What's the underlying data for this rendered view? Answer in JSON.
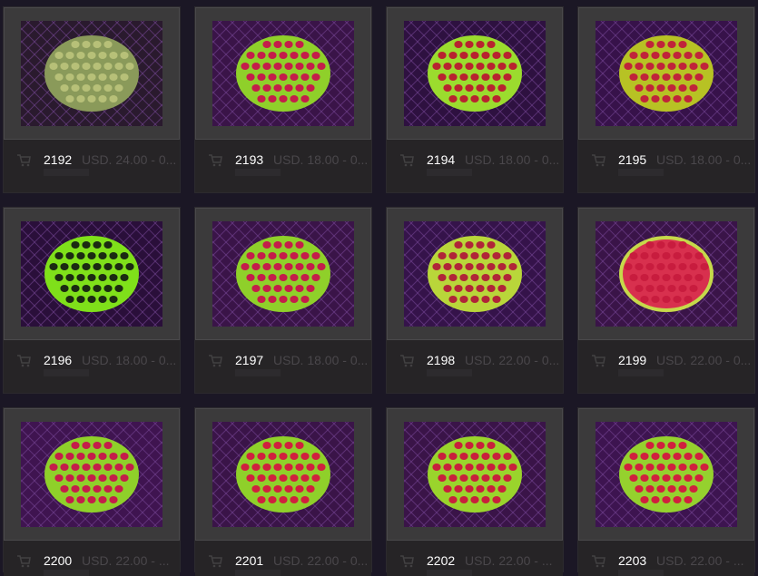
{
  "products": [
    {
      "title": "2192",
      "price": "USD. 24.00 - 0..."
    },
    {
      "title": "2193",
      "price": "USD. 18.00 - 0..."
    },
    {
      "title": "2194",
      "price": "USD. 18.00 - 0..."
    },
    {
      "title": "2195",
      "price": "USD. 18.00 - 0..."
    },
    {
      "title": "2196",
      "price": "USD. 18.00 - 0..."
    },
    {
      "title": "2197",
      "price": "USD. 18.00 - 0..."
    },
    {
      "title": "2198",
      "price": "USD. 22.00 - 0..."
    },
    {
      "title": "2199",
      "price": "USD. 22.00 - 0..."
    },
    {
      "title": "2200",
      "price": "USD. 22.00 - ..."
    },
    {
      "title": "2201",
      "price": "USD. 22.00 - 0..."
    },
    {
      "title": "2202",
      "price": "USD. 22.00 - ..."
    },
    {
      "title": "2203",
      "price": "USD. 22.00 - ..."
    }
  ],
  "icons": {
    "cart": "shopping-cart-icon"
  },
  "colors": {
    "background": "#1b1725",
    "card_frame": "#3b3a3b",
    "footer": "#262426",
    "coral_green": "#9be232",
    "coral_red": "#d01f45",
    "coral_purple": "#6b2b8a"
  }
}
